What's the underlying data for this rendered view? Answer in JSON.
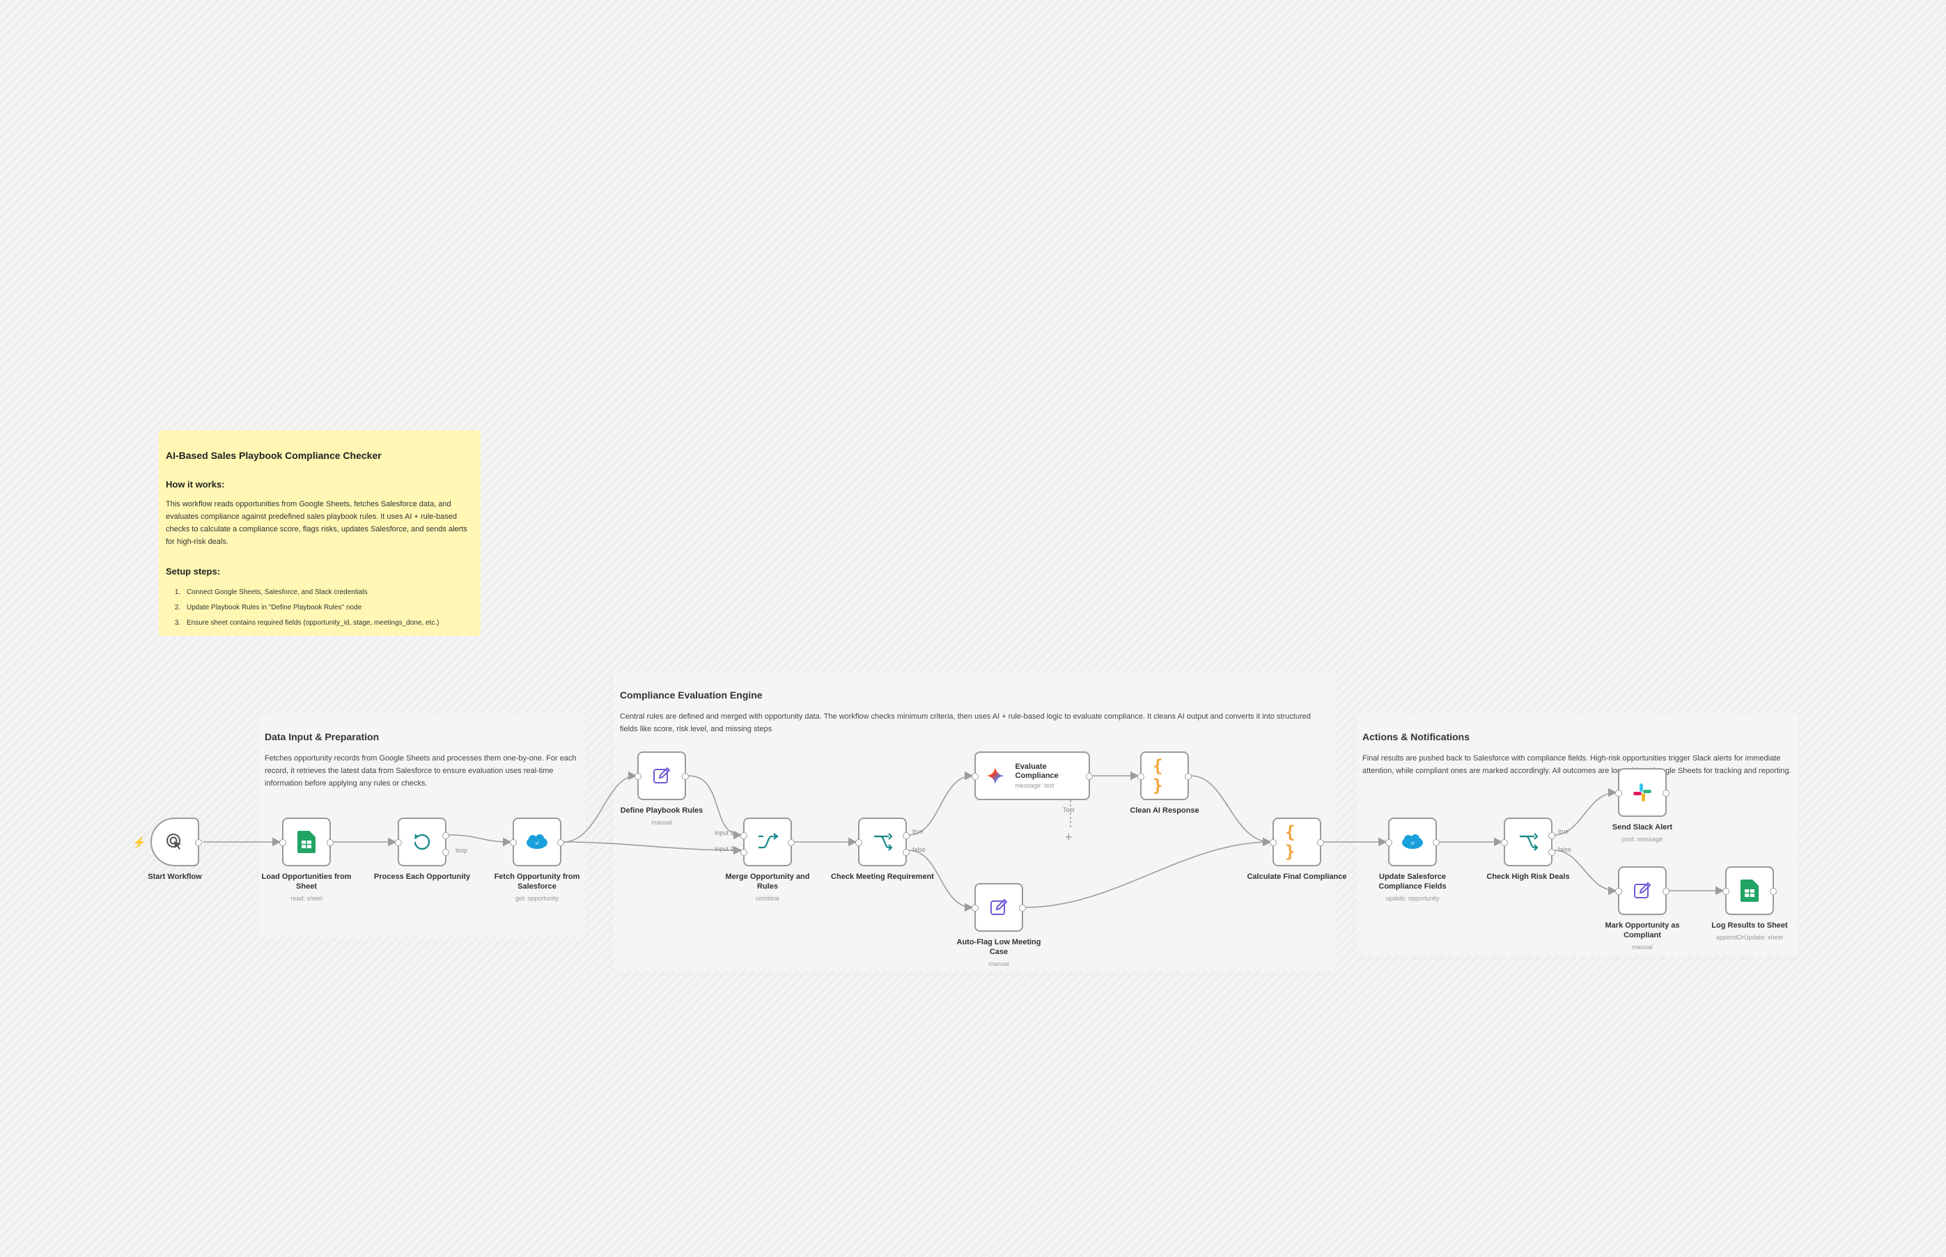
{
  "sticky": {
    "title": "AI-Based Sales Playbook Compliance Checker",
    "how_heading": "How it works:",
    "how_text": "This workflow reads opportunities from Google Sheets, fetches Salesforce data, and evaluates compliance against predefined sales playbook rules. It uses AI + rule-based checks to calculate a compliance score, flags risks, updates Salesforce, and sends alerts for high-risk deals.",
    "setup_heading": "Setup steps:",
    "steps": [
      "Connect Google Sheets, Salesforce, and Slack credentials",
      "Update Playbook Rules in \"Define Playbook Rules\" node",
      "Ensure sheet contains required fields (opportunity_id, stage, meetings_done, etc.)"
    ]
  },
  "groups": {
    "data": {
      "title": "Data Input & Preparation",
      "desc": "Fetches opportunity records from Google Sheets and processes them one-by-one. For each record, it retrieves the latest data from Salesforce to ensure evaluation uses real-time information before applying any rules or checks."
    },
    "compliance": {
      "title": "Compliance Evaluation Engine",
      "desc": "Central rules are defined and merged with opportunity data. The workflow checks minimum criteria, then uses AI + rule-based logic to evaluate compliance. It cleans AI output and converts it into structured fields like score, risk level, and missing steps"
    },
    "actions": {
      "title": "Actions & Notifications",
      "desc": "Final results are pushed back to Salesforce with compliance fields. High-risk opportunities trigger Slack alerts for immediate attention, while compliant ones are marked accordingly. All outcomes are logged into Google Sheets for tracking and reporting."
    }
  },
  "nodes": {
    "start": {
      "label": "Start Workflow",
      "sub": ""
    },
    "load": {
      "label": "Load Opportunities from Sheet",
      "sub": "read: sheet"
    },
    "process": {
      "label": "Process Each Opportunity",
      "sub": ""
    },
    "fetch": {
      "label": "Fetch Opportunity from Salesforce",
      "sub": "get: opportunity"
    },
    "define": {
      "label": "Define Playbook Rules",
      "sub": "manual"
    },
    "merge": {
      "label": "Merge Opportunity and Rules",
      "sub": "combine"
    },
    "checkmeet": {
      "label": "Check Meeting Requirement",
      "sub": ""
    },
    "evaluate": {
      "label": "Evaluate Compliance",
      "sub": "message: text"
    },
    "clean": {
      "label": "Clean AI Response",
      "sub": ""
    },
    "autoflag": {
      "label": "Auto-Flag Low Meeting Case",
      "sub": "manual"
    },
    "calc": {
      "label": "Calculate Final Compliance",
      "sub": ""
    },
    "updatesf": {
      "label": "Update Salesforce Compliance Fields",
      "sub": "update: opportunity"
    },
    "checkrisk": {
      "label": "Check High Risk Deals",
      "sub": ""
    },
    "slack": {
      "label": "Send Slack Alert",
      "sub": "post: message"
    },
    "mark": {
      "label": "Mark Opportunity as Compliant",
      "sub": "manual"
    },
    "log": {
      "label": "Log Results to Sheet",
      "sub": "appendOrUpdate: sheet"
    }
  },
  "edge_labels": {
    "loop": "loop",
    "input1": "Input 1",
    "input2": "Input 2",
    "true": "true",
    "false": "false",
    "tool": "Tool"
  },
  "colors": {
    "sticky": "#fff7b3",
    "edge": "#9c9c9c",
    "sheets": "#21a464",
    "salesforce": "#1ba0dc",
    "edit": "#6b5bd6",
    "teal": "#1b8a8a",
    "code": "#f2a33a",
    "trigger_bolt": "#ff6d2d"
  }
}
